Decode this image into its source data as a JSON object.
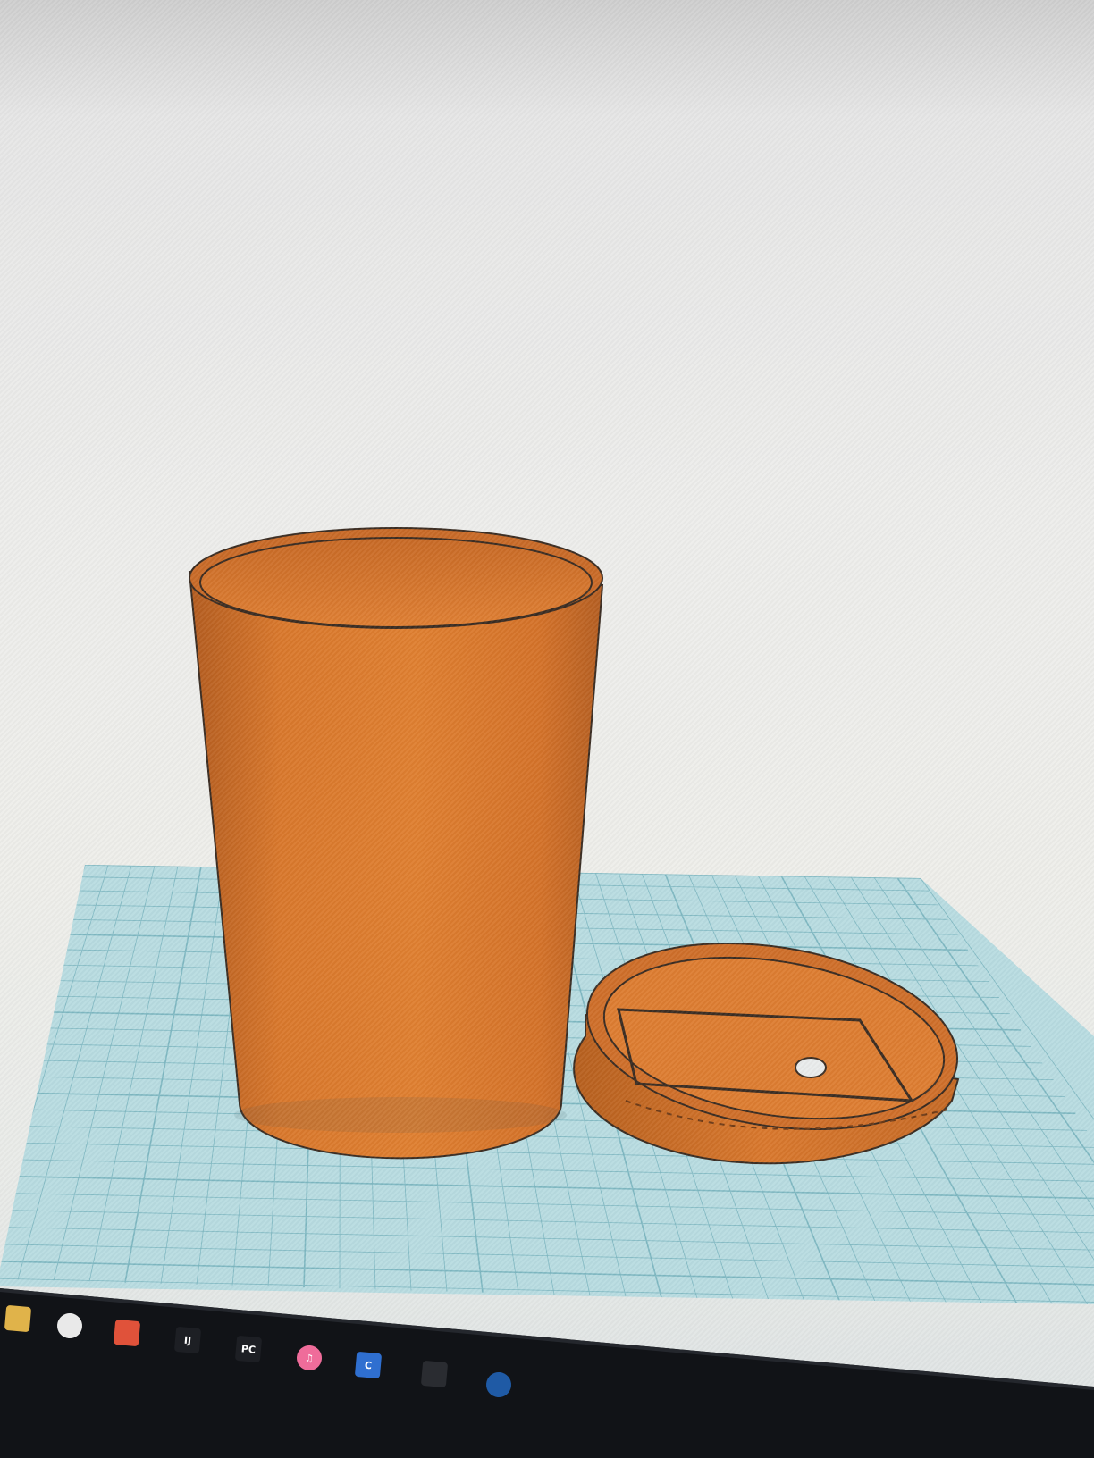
{
  "colors": {
    "object_orange": "#d8772a",
    "object_shadow": "#a9551b",
    "object_highlight": "#e58a3a",
    "workplane": "#b5dbe0",
    "grid_line": "#7fb8c2",
    "taskbar": "#101216",
    "edge": "#2e2b28"
  },
  "taskbar": {
    "icons": [
      {
        "name": "file-explorer-icon",
        "glyph": "",
        "bg": "#e0b34a",
        "fg": "#7a5a14"
      },
      {
        "name": "cortana-icon",
        "glyph": "",
        "bg": "#e9e9e9",
        "fg": "#111111"
      },
      {
        "name": "brave-browser-icon",
        "glyph": "",
        "bg": "#e0523a",
        "fg": "#ffffff"
      },
      {
        "name": "intellij-idea-icon",
        "glyph": "IJ",
        "bg": "#1d1f24",
        "fg": "#ffffff"
      },
      {
        "name": "pycharm-icon",
        "glyph": "PC",
        "bg": "#1d1f24",
        "fg": "#ffffff"
      },
      {
        "name": "itunes-icon",
        "glyph": "♫",
        "bg": "#ef6c9a",
        "fg": "#ffffff"
      },
      {
        "name": "cura-icon",
        "glyph": "C",
        "bg": "#2f6fd0",
        "fg": "#ffffff"
      },
      {
        "name": "library-books-icon",
        "glyph": "",
        "bg": "#2a2c31",
        "fg": "#9a9a9a"
      },
      {
        "name": "dome-app-icon",
        "glyph": "",
        "bg": "#1f5aa5",
        "fg": "#ffffff"
      }
    ]
  }
}
